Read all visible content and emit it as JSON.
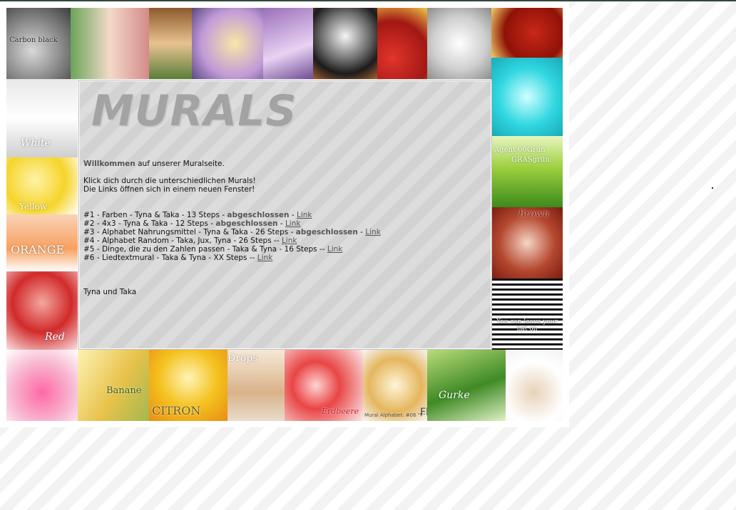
{
  "heading": "MURALS",
  "intro": {
    "welcome_bold": "Willkommen",
    "welcome_rest": " auf unserer Muralseite.",
    "line2": "Klick dich durch die unterschiedlichen Murals!",
    "line3": "Die Links öffnen sich in einem neuen Fenster!"
  },
  "murals": [
    {
      "prefix": "#1 - Farben - Tyna & Taka - 13 Steps - ",
      "status": "abgeschlossen",
      "sep": " - ",
      "link": "Link"
    },
    {
      "prefix": "#2 - 4x3 - Tyna & Taka - 12 Steps - ",
      "status": "abgeschlossen",
      "sep": " - ",
      "link": "Link"
    },
    {
      "prefix": "#3 - Alphabet Nahrungsmittel - Tyna & Taka - 26 Steps - ",
      "status": "abgeschlossen",
      "sep": " - ",
      "link": "Link"
    },
    {
      "prefix": "#4 - Alphabet Random - Taka, Jux, Tyna - 26 Steps -- ",
      "status": "",
      "sep": "",
      "link": "Link"
    },
    {
      "prefix": "#5 - Dinge, die zu den Zahlen passen - Taka & Tyna - 16 Steps -- ",
      "status": "",
      "sep": "",
      "link": "Link"
    },
    {
      "prefix": "#6 - Liedtextmural - Taka & Tyna - XX Steps -- ",
      "status": "",
      "sep": "",
      "link": "Link"
    }
  ],
  "signature": "Tyna und Taka",
  "tiles": {
    "carbon": "Carbon black",
    "white": "White",
    "yellow": "Yellow",
    "orange": "ORANGE",
    "red": "Red",
    "agent": "Agent 00Grün",
    "grasgruen": "GRASgrün",
    "brown": "Brown",
    "bw": "You can leave your hat on",
    "banana": "Banane",
    "citron": "CITRON",
    "drops": "Drops",
    "erdbeere": "Erdbeere",
    "flan": "Flan",
    "flan_caption": "Mural Alphabet: #06 \"F\"",
    "gurke": "Gurke"
  }
}
